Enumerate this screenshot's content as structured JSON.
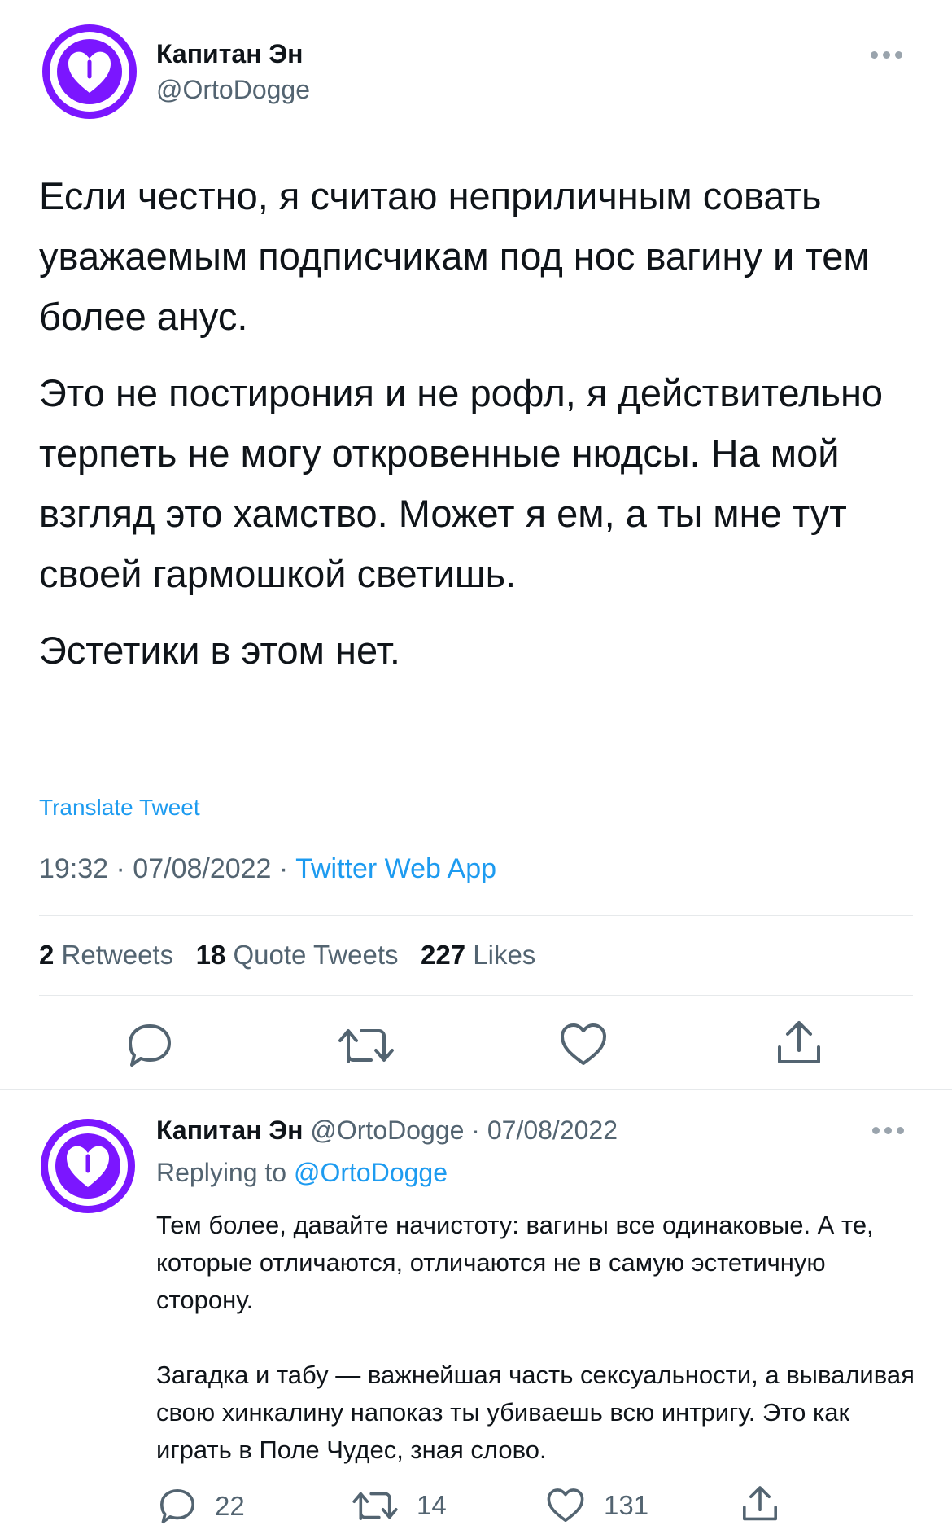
{
  "main_tweet": {
    "author_name": "Капитан Эн",
    "handle": "@OrtoDogge",
    "paragraphs": [
      "Если честно, я считаю неприличным совать уважаемым подписчикам под нос вагину и тем более анус.",
      "Это не постирония и не рофл, я действительно терпеть не могу откровенные нюдсы. На мой взгляд это хамство. Может я ем, а ты мне тут своей гармошкой светишь.",
      "Эстетики в этом нет."
    ],
    "translate_label": "Translate Tweet",
    "timestamp": "19:32 · 07/08/2022 · ",
    "source": "Twitter Web App",
    "stats": {
      "retweets_count": "2",
      "retweets_label": "Retweets",
      "quotes_count": "18",
      "quotes_label": "Quote Tweets",
      "likes_count": "227",
      "likes_label": "Likes"
    }
  },
  "reply_tweet": {
    "author_name": "Капитан Эн",
    "meta": "@OrtoDogge · 07/08/2022",
    "replying_prefix": "Replying to ",
    "replying_handle": "@OrtoDogge",
    "paragraphs": [
      "Тем более, давайте начистоту: вагины все одинаковые. А те, которые отличаются, отличаются не в самую эстетичную сторону.",
      "Загадка и табу — важнейшая часть сексуальности, а вываливая свою хинкалину напоказ ты убиваешь всю интригу. Это как играть в Поле Чудес, зная слово."
    ],
    "reply_count": "22",
    "retweet_count": "14",
    "like_count": "131"
  },
  "icons": {
    "avatar": "purple-heart-logo-icon",
    "more": "more-dots-icon",
    "reply": "speech-bubble-icon",
    "retweet": "retweet-arrows-icon",
    "like": "heart-outline-icon",
    "share": "share-upload-icon"
  },
  "colors": {
    "accent": "#1d9bf0",
    "avatar": "#7b16ff",
    "muted": "#536471"
  }
}
